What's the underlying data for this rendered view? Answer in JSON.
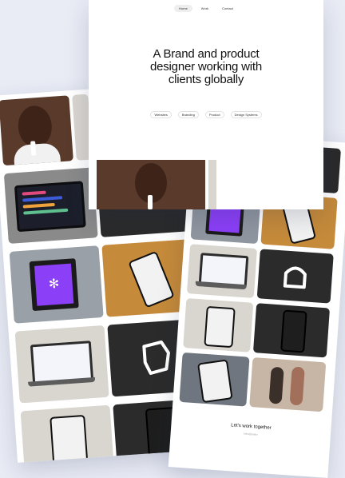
{
  "nav": {
    "items": [
      "Home",
      "Work",
      "Contact"
    ],
    "active": "Home"
  },
  "hero": {
    "headline_line1": "A Brand and product",
    "headline_line2": "designer working with",
    "headline_line3": "clients globally"
  },
  "chips": [
    "Websites",
    "Branding",
    "Product",
    "Design Systems"
  ],
  "footer": {
    "title": "Let's work together",
    "subtitle": "hello@studio"
  },
  "colors": {
    "background": "#e9ecf5",
    "accent_purple": "#8b3ff6",
    "card_dark": "#2b2b2b"
  }
}
